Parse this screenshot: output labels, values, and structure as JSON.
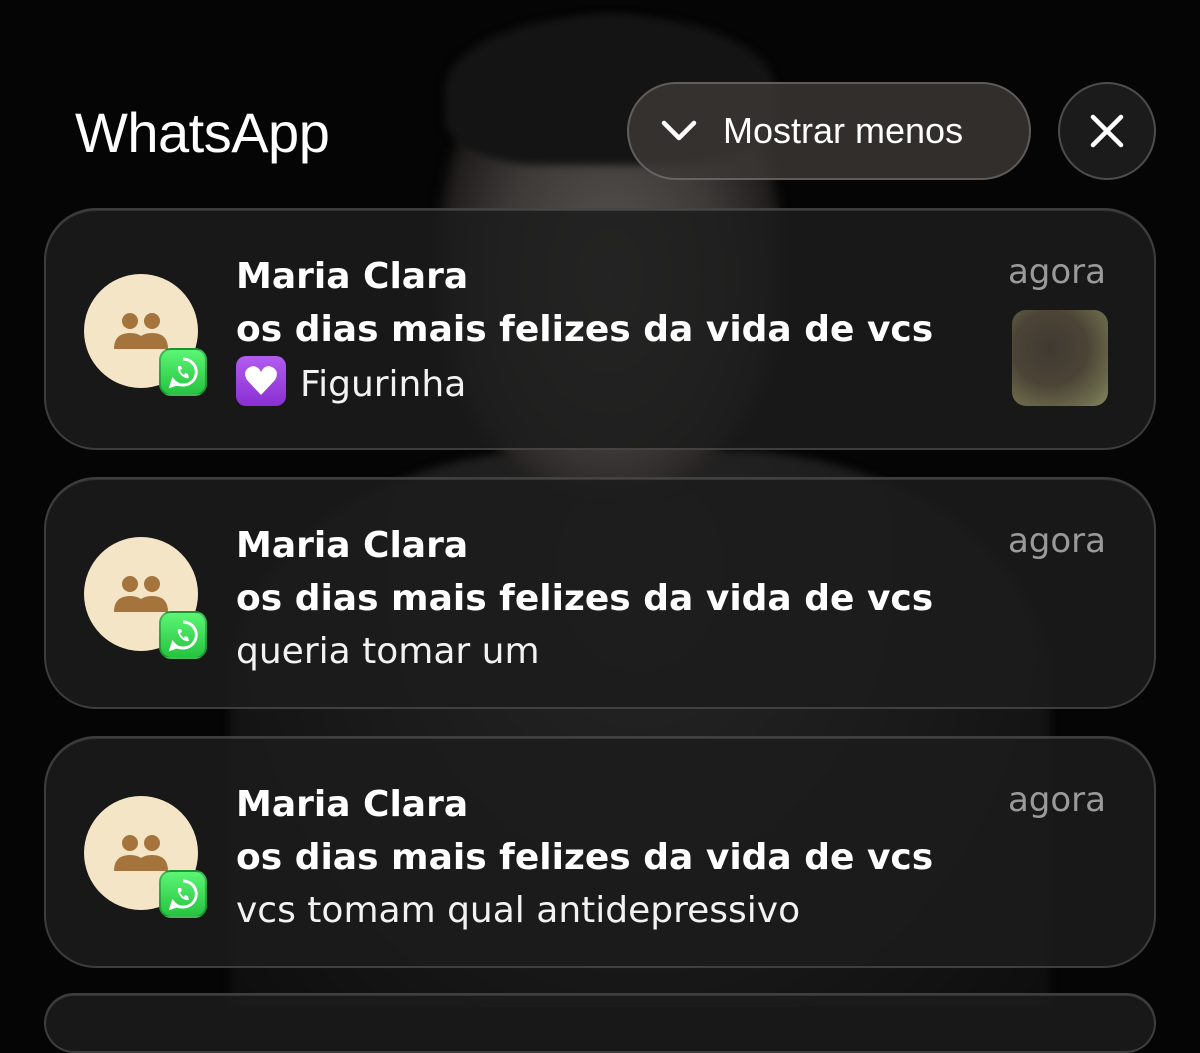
{
  "header": {
    "app_name": "WhatsApp",
    "show_less_label": "Mostrar menos"
  },
  "notifications": [
    {
      "sender": "Maria Clara",
      "group": "os dias mais felizes da vida de vcs",
      "message": "Figurinha",
      "message_emoji": "purple-heart-icon",
      "time": "agora",
      "has_thumbnail": true
    },
    {
      "sender": "Maria Clara",
      "group": "os dias mais felizes da vida de vcs",
      "message": "queria tomar um",
      "time": "agora"
    },
    {
      "sender": "Maria Clara",
      "group": "os dias mais felizes da vida de vcs",
      "message": "vcs tomam qual antidepressivo",
      "time": "agora"
    }
  ],
  "colors": {
    "avatar_bg": "#f3e5c6",
    "avatar_icon": "#a5743c",
    "whatsapp_green": "#25c43f",
    "timestamp": "#9a9a9a"
  }
}
